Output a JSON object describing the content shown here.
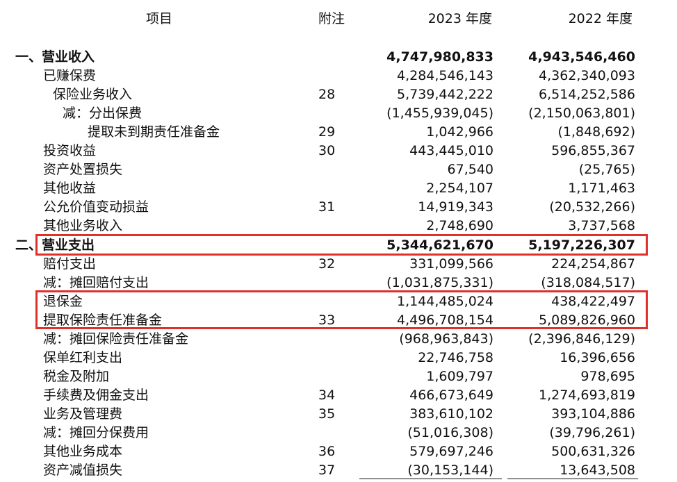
{
  "header": {
    "item": "项目",
    "note": "附注",
    "year2023": "2023 年度",
    "year2022": "2022 年度"
  },
  "rows": [
    {
      "label": "一、营业收入",
      "note": "",
      "v2023": "4,747,980,833",
      "v2022": "4,943,546,460"
    },
    {
      "label": "已赚保费",
      "note": "",
      "v2023": "4,284,546,143",
      "v2022": "4,362,340,093"
    },
    {
      "label": "保险业务收入",
      "note": "28",
      "v2023": "5,739,442,222",
      "v2022": "6,514,252,586"
    },
    {
      "label": "减：分出保费",
      "note": "",
      "v2023": "(1,455,939,045)",
      "v2022": "(2,150,063,801)"
    },
    {
      "label": "提取未到期责任准备金",
      "note": "29",
      "v2023": "1,042,966",
      "v2022": "(1,848,692)"
    },
    {
      "label": "投资收益",
      "note": "30",
      "v2023": "443,445,010",
      "v2022": "596,855,367"
    },
    {
      "label": "资产处置损失",
      "note": "",
      "v2023": "67,540",
      "v2022": "(25,765)"
    },
    {
      "label": "其他收益",
      "note": "",
      "v2023": "2,254,107",
      "v2022": "1,171,463"
    },
    {
      "label": "公允价值变动损益",
      "note": "31",
      "v2023": "14,919,343",
      "v2022": "(20,532,266)"
    },
    {
      "label": "其他业务收入",
      "note": "",
      "v2023": "2,748,690",
      "v2022": "3,737,568"
    },
    {
      "label": "二、营业支出",
      "note": "",
      "v2023": "5,344,621,670",
      "v2022": "5,197,226,307"
    },
    {
      "label": "赔付支出",
      "note": "32",
      "v2023": "331,099,566",
      "v2022": "224,254,867"
    },
    {
      "label": "减：摊回赔付支出",
      "note": "",
      "v2023": "(1,031,875,331)",
      "v2022": "(318,084,517)"
    },
    {
      "label": "退保金",
      "note": "",
      "v2023": "1,144,485,024",
      "v2022": "438,422,497"
    },
    {
      "label": "提取保险责任准备金",
      "note": "33",
      "v2023": "4,496,708,154",
      "v2022": "5,089,826,960"
    },
    {
      "label": "减：摊回保险责任准备金",
      "note": "",
      "v2023": "(968,963,843)",
      "v2022": "(2,396,846,129)"
    },
    {
      "label": "保单红利支出",
      "note": "",
      "v2023": "22,746,758",
      "v2022": "16,396,656"
    },
    {
      "label": "税金及附加",
      "note": "",
      "v2023": "1,609,797",
      "v2022": "978,695"
    },
    {
      "label": "手续费及佣金支出",
      "note": "34",
      "v2023": "466,673,649",
      "v2022": "1,274,693,819"
    },
    {
      "label": "业务及管理费",
      "note": "35",
      "v2023": "383,610,102",
      "v2022": "393,104,886"
    },
    {
      "label": "减：摊回分保费用",
      "note": "",
      "v2023": "(51,016,308)",
      "v2022": "(39,796,261)"
    },
    {
      "label": "其他业务成本",
      "note": "36",
      "v2023": "579,697,246",
      "v2022": "500,631,326"
    },
    {
      "label": "资产减值损失",
      "note": "37",
      "v2023": "(30,153,144)",
      "v2022": "13,643,508"
    }
  ],
  "highlight_color": "#e0302a"
}
